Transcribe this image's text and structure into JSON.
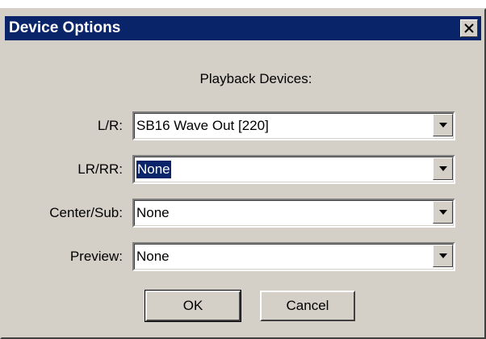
{
  "window": {
    "title": "Device Options",
    "close_label": "×"
  },
  "dialog": {
    "heading": "Playback Devices:",
    "fields": [
      {
        "label": "L/R:",
        "value": "SB16 Wave Out [220]"
      },
      {
        "label": "LR/RR:",
        "value": "None"
      },
      {
        "label": "Center/Sub:",
        "value": "None"
      },
      {
        "label": "Preview:",
        "value": "None"
      }
    ]
  },
  "buttons": {
    "ok_label": "OK",
    "cancel_label": "Cancel"
  },
  "icons": {
    "close": "close-icon",
    "dropdown": "chevron-down-icon"
  },
  "colors": {
    "titlebar": "#0a246a",
    "face": "#d4d0c8",
    "selection": "#0a246a"
  }
}
